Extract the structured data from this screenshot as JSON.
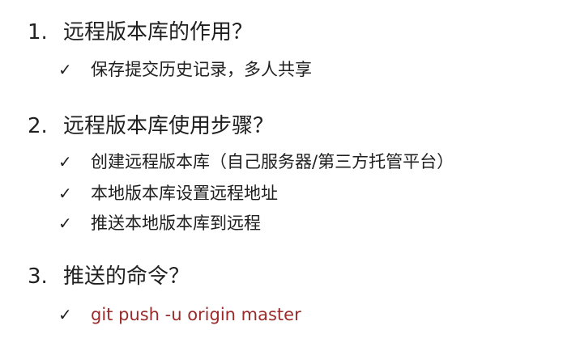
{
  "sections": [
    {
      "number": "1.",
      "title": "远程版本库的作用？",
      "items": [
        {
          "check": "✓",
          "text": "保存提交历史记录，多人共享"
        }
      ]
    },
    {
      "number": "2.",
      "title": "远程版本库使用步骤？",
      "items": [
        {
          "check": "✓",
          "text": "创建远程版本库（自己服务器/第三方托管平台）"
        },
        {
          "check": "✓",
          "text": "本地版本库设置远程地址"
        },
        {
          "check": "✓",
          "text": "推送本地版本库到远程"
        }
      ]
    },
    {
      "number": "3.",
      "title": "推送的命令？",
      "items": [
        {
          "check": "✓",
          "text": "git push -u origin master"
        }
      ]
    }
  ],
  "colors": {
    "text": "#1f1f1f",
    "command": "#9b2a2a",
    "background": "#ffffff"
  }
}
